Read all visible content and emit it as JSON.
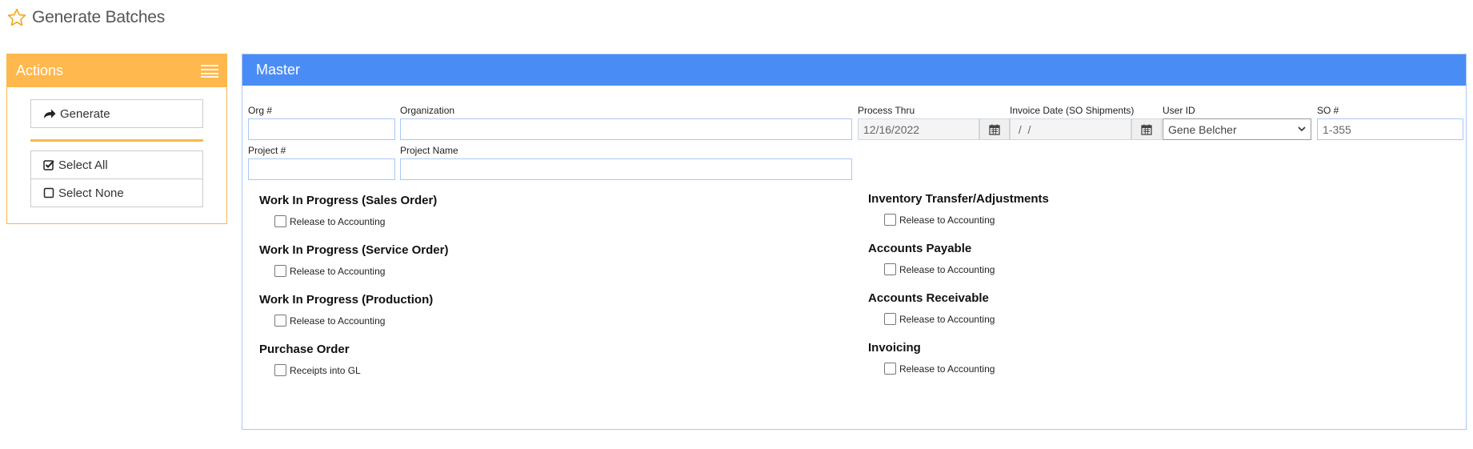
{
  "page": {
    "title": "Generate Batches",
    "accent_color": "#ffb84d",
    "master_color": "#4a8cf6"
  },
  "actions": {
    "header": "Actions",
    "generate": "Generate",
    "select_all": "Select All",
    "select_none": "Select None"
  },
  "master": {
    "header": "Master",
    "fields": {
      "org_num": {
        "label": "Org #",
        "value": ""
      },
      "organization": {
        "label": "Organization",
        "value": ""
      },
      "process_thru": {
        "label": "Process Thru",
        "value": "12/16/2022"
      },
      "invoice_date": {
        "label": "Invoice Date (SO Shipments)",
        "value": " /  /"
      },
      "user_id": {
        "label": "User ID",
        "value": "Gene Belcher"
      },
      "so_num": {
        "label": "SO #",
        "value": "1-355"
      },
      "project_num": {
        "label": "Project #",
        "value": ""
      },
      "project_name": {
        "label": "Project Name",
        "value": ""
      }
    },
    "sections_left": [
      {
        "title": "Work In Progress (Sales Order)",
        "option": "Release to Accounting"
      },
      {
        "title": "Work In Progress (Service Order)",
        "option": "Release to Accounting"
      },
      {
        "title": "Work In Progress (Production)",
        "option": "Release to Accounting"
      },
      {
        "title": "Purchase Order",
        "option": "Receipts into GL"
      }
    ],
    "sections_right": [
      {
        "title": "Inventory Transfer/Adjustments",
        "option": "Release to Accounting"
      },
      {
        "title": "Accounts Payable",
        "option": "Release to Accounting"
      },
      {
        "title": "Accounts Receivable",
        "option": "Release to Accounting"
      },
      {
        "title": "Invoicing",
        "option": "Release to Accounting"
      }
    ]
  }
}
